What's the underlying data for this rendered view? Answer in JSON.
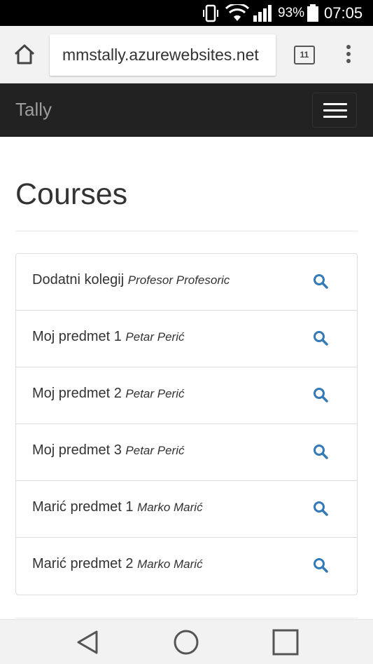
{
  "status_bar": {
    "battery_percent": "93%",
    "time": "07:05",
    "icons": [
      "vibrate-icon",
      "wifi-icon",
      "signal-icon",
      "battery-icon"
    ]
  },
  "browser": {
    "url": "mmstally.azurewebsites.net",
    "tab_count": "11",
    "icons": [
      "home-icon",
      "tabs-icon",
      "overflow-menu-icon"
    ]
  },
  "navbar": {
    "brand": "Tally",
    "toggle_icon": "hamburger-icon"
  },
  "page": {
    "title": "Courses"
  },
  "courses": [
    {
      "name": "Dodatni kolegij",
      "professor": "Profesor Profesoric"
    },
    {
      "name": "Moj predmet 1",
      "professor": "Petar Perić"
    },
    {
      "name": "Moj predmet 2",
      "professor": "Petar Perić"
    },
    {
      "name": "Moj predmet 3",
      "professor": "Petar Perić"
    },
    {
      "name": "Marić predmet 1",
      "professor": "Marko Marić"
    },
    {
      "name": "Marić predmet 2",
      "professor": "Marko Marić"
    }
  ],
  "colors": {
    "navbar_bg": "#222222",
    "brand": "#9d9d9d",
    "accent_icon": "#337ab7",
    "text": "#333333"
  },
  "system_nav": [
    "back-icon",
    "home-circle-icon",
    "recents-icon"
  ]
}
